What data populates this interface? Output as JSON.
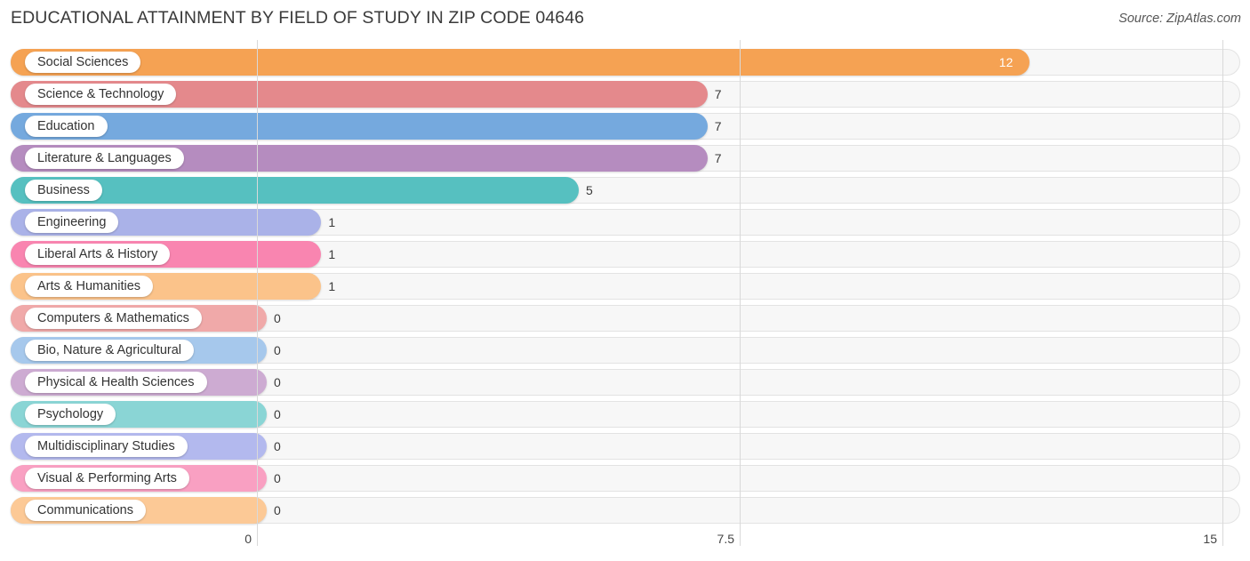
{
  "header": {
    "title": "EDUCATIONAL ATTAINMENT BY FIELD OF STUDY IN ZIP CODE 04646",
    "source": "Source: ZipAtlas.com"
  },
  "chart_data": {
    "type": "bar",
    "orientation": "horizontal",
    "title": "EDUCATIONAL ATTAINMENT BY FIELD OF STUDY IN ZIP CODE 04646",
    "xlabel": "",
    "ylabel": "",
    "xlim": [
      0,
      15
    ],
    "grid": true,
    "legend": "none",
    "tick_labels": [
      "0",
      "7.5",
      "15"
    ],
    "tick_values": [
      0,
      7.5,
      15
    ],
    "categories": [
      "Social Sciences",
      "Science & Technology",
      "Education",
      "Literature & Languages",
      "Business",
      "Engineering",
      "Liberal Arts & History",
      "Arts & Humanities",
      "Computers & Mathematics",
      "Bio, Nature & Agricultural",
      "Physical & Health Sciences",
      "Psychology",
      "Multidisciplinary Studies",
      "Visual & Performing Arts",
      "Communications"
    ],
    "values": [
      12,
      7,
      7,
      7,
      5,
      1,
      1,
      1,
      0,
      0,
      0,
      0,
      0,
      0,
      0
    ],
    "value_labels": [
      "12",
      "7",
      "7",
      "7",
      "5",
      "1",
      "1",
      "1",
      "0",
      "0",
      "0",
      "0",
      "0",
      "0",
      "0"
    ],
    "colors": [
      "#f5a253",
      "#e4898c",
      "#75a9de",
      "#b58cbf",
      "#56c0c0",
      "#aab2e8",
      "#f985b0",
      "#fbc38a",
      "#f0a9a9",
      "#a6c8ec",
      "#cdabd2",
      "#8ad5d5",
      "#b3b9ee",
      "#f9a0c2",
      "#fcc996"
    ]
  }
}
